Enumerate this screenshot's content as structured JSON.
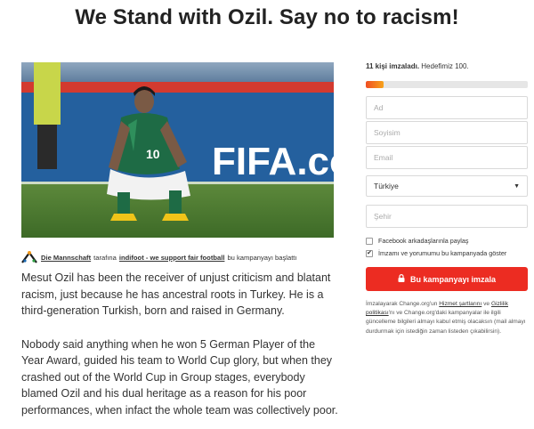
{
  "page": {
    "title": "We Stand with Ozil. Say no to racism!"
  },
  "photo": {
    "alt": "FIFA.com",
    "banner_text": "FIFA.com",
    "jersey_number": "10"
  },
  "starter": {
    "organizer": "Die Mannschaft",
    "middle_text": "tarafına",
    "campaign_link": "indifoot - we support fair football",
    "suffix": "bu kampanyayı başlattı"
  },
  "story": {
    "paragraphs": [
      "Mesut Ozil has been the receiver of unjust criticism and blatant racism, just because he has ancestral roots in Turkey. He is a third-generation Turkish, born and raised in Germany.",
      "Nobody said anything when he won 5 German Player of the Year Award, guided his team to World Cup glory, but when they crashed out of the World Cup in Group stages, everybody blamed Ozil and his dual heritage as a reason for his poor performances, when infact the whole team was collectively poor."
    ]
  },
  "signatures": {
    "count_text": "11 kişi imzaladı.",
    "goal_text": "Hedefimiz 100.",
    "progress_fraction": 0.11
  },
  "form": {
    "first_name_placeholder": "Ad",
    "last_name_placeholder": "Soyisim",
    "email_placeholder": "Email",
    "country_value": "Türkiye",
    "city_placeholder": "Şehir",
    "facebook_label": "Facebook arkadaşlarınla paylaş",
    "facebook_checked": false,
    "show_name_label": "İmzamı ve yorumumu bu kampanyada göster",
    "show_name_checked": true,
    "sign_button": "Bu kampanyayı imzala"
  },
  "legal": {
    "part1": "İmzalayarak Change.org'un",
    "terms_link": "Hizmet şartlarını",
    "part2": "ve",
    "privacy_link": "Gizlilik politikası",
    "part3": "'nı ve Change.org'daki kampanyalar ile ilgili güncelleme bilgileri almayı kabul etmiş olacaksın (mail almayı durdurmak için istediğin zaman listeden çıkabilirsin)."
  },
  "colors": {
    "accent": "#ec2c22",
    "progress_start": "#f04e23",
    "progress_end": "#f7a31b"
  }
}
